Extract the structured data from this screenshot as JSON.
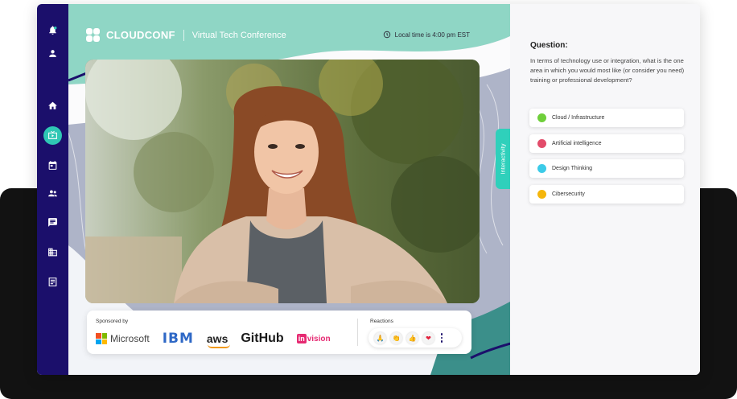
{
  "brand": {
    "name": "CLOUDCONF",
    "subtitle": "Virtual Tech Conference"
  },
  "header": {
    "local_time": "Local time is 4:00 pm EST",
    "clock_icon": "clock-icon"
  },
  "sidebar": {
    "items": [
      {
        "icon": "bell-icon"
      },
      {
        "icon": "user-icon"
      },
      {
        "icon": "home-icon"
      },
      {
        "icon": "live-stream-icon",
        "active": true
      },
      {
        "icon": "calendar-icon"
      },
      {
        "icon": "people-icon"
      },
      {
        "icon": "chat-icon"
      },
      {
        "icon": "building-icon"
      },
      {
        "icon": "notes-icon"
      }
    ]
  },
  "interactivity_tab": "Interactivity",
  "sponsors": {
    "label": "Sponsored by",
    "logos": [
      "Microsoft",
      "IBM",
      "aws",
      "GitHub",
      "in",
      "vision"
    ]
  },
  "reactions": {
    "label": "Reactions",
    "items": [
      "🙏",
      "👏",
      "👍",
      "❤"
    ]
  },
  "question": {
    "title": "Question:",
    "text": "In terms of technology use or integration, what is the one area in which you would most like (or consider you need) training or professional development?",
    "options": [
      {
        "label": "Cloud / Infrastructure",
        "color": "#6fcf3a"
      },
      {
        "label": "Artificial intelligence",
        "color": "#e24c6a"
      },
      {
        "label": "Design Thinking",
        "color": "#3ccbe8"
      },
      {
        "label": "Cibersecurity",
        "color": "#f5b60c"
      }
    ]
  },
  "colors": {
    "sidebar": "#1b0f6b",
    "accent": "#2fc7b4",
    "header_band": "#8fd6c5"
  }
}
